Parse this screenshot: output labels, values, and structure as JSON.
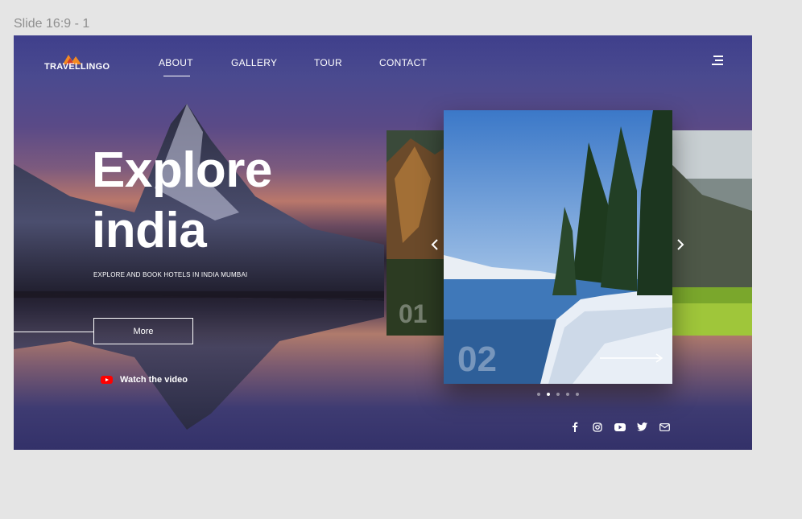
{
  "canvas": {
    "frame_label": "Slide 16:9 - 1"
  },
  "header": {
    "logo_text": "TRAVELLINGO",
    "nav": [
      {
        "label": "ABOUT",
        "active": true
      },
      {
        "label": "GALLERY",
        "active": false
      },
      {
        "label": "TOUR",
        "active": false
      },
      {
        "label": "CONTACT",
        "active": false
      }
    ],
    "menu_icon": "hamburger-menu-icon"
  },
  "hero": {
    "title_line1": "Explore",
    "title_line2": "india",
    "subtitle": "EXPLORE AND BOOK HOTELS IN INDIA MUMBAI",
    "more_label": "More",
    "watch_label": "Watch the video"
  },
  "carousel": {
    "cards": [
      {
        "number": "01"
      },
      {
        "number": "02"
      }
    ],
    "prev_icon": "chevron-left-icon",
    "next_icon": "chevron-right-icon",
    "dots": 5,
    "active_dot": 1
  },
  "socials": [
    "facebook-icon",
    "instagram-icon",
    "youtube-icon",
    "twitter-icon",
    "mail-icon"
  ],
  "colors": {
    "accent": "#ff0000",
    "sky": "#4c81c9",
    "bg": "#3f3f8c"
  }
}
